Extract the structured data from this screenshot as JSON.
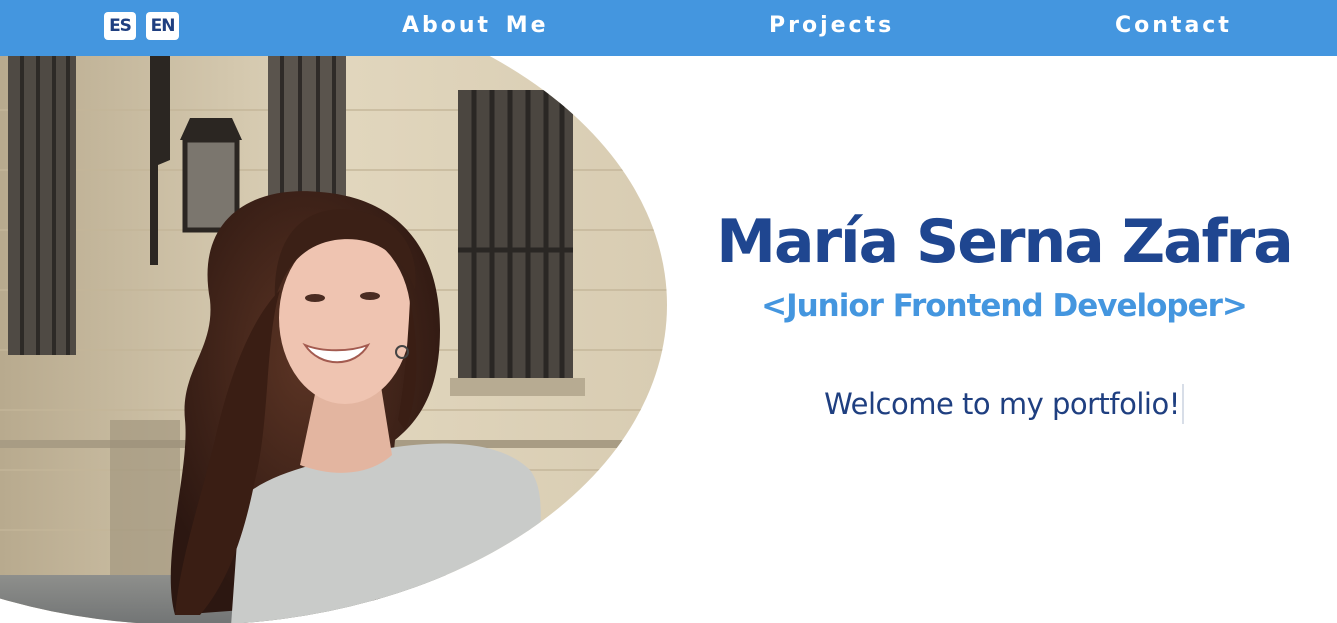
{
  "nav": {
    "languages": [
      "ES",
      "EN"
    ],
    "links": [
      "About Me",
      "Projects",
      "Contact"
    ]
  },
  "hero": {
    "name": "María Serna Zafra",
    "role": "<Junior Frontend Developer>",
    "welcome": "Welcome to my portfolio!"
  },
  "colors": {
    "navbar": "#4496df",
    "name": "#1f4690",
    "role": "#4496df",
    "text": "#1f3f80"
  }
}
